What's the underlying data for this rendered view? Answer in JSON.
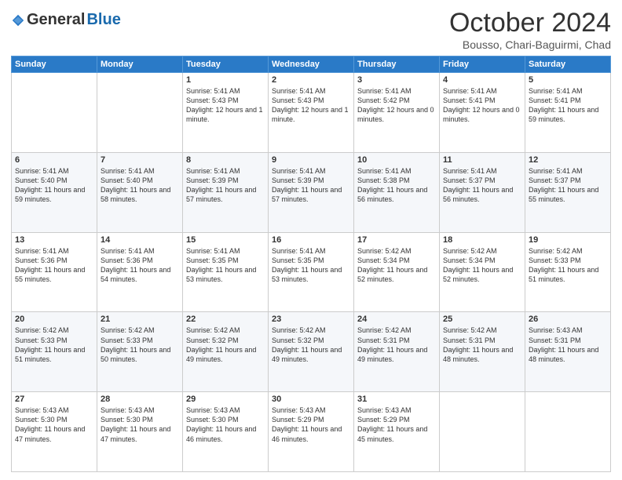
{
  "header": {
    "logo_general": "General",
    "logo_blue": "Blue",
    "month_title": "October 2024",
    "location": "Bousso, Chari-Baguirmi, Chad"
  },
  "days_of_week": [
    "Sunday",
    "Monday",
    "Tuesday",
    "Wednesday",
    "Thursday",
    "Friday",
    "Saturday"
  ],
  "weeks": [
    [
      {
        "day": "",
        "sunrise": "",
        "sunset": "",
        "daylight": ""
      },
      {
        "day": "",
        "sunrise": "",
        "sunset": "",
        "daylight": ""
      },
      {
        "day": "1",
        "sunrise": "Sunrise: 5:41 AM",
        "sunset": "Sunset: 5:43 PM",
        "daylight": "Daylight: 12 hours and 1 minute."
      },
      {
        "day": "2",
        "sunrise": "Sunrise: 5:41 AM",
        "sunset": "Sunset: 5:43 PM",
        "daylight": "Daylight: 12 hours and 1 minute."
      },
      {
        "day": "3",
        "sunrise": "Sunrise: 5:41 AM",
        "sunset": "Sunset: 5:42 PM",
        "daylight": "Daylight: 12 hours and 0 minutes."
      },
      {
        "day": "4",
        "sunrise": "Sunrise: 5:41 AM",
        "sunset": "Sunset: 5:41 PM",
        "daylight": "Daylight: 12 hours and 0 minutes."
      },
      {
        "day": "5",
        "sunrise": "Sunrise: 5:41 AM",
        "sunset": "Sunset: 5:41 PM",
        "daylight": "Daylight: 11 hours and 59 minutes."
      }
    ],
    [
      {
        "day": "6",
        "sunrise": "Sunrise: 5:41 AM",
        "sunset": "Sunset: 5:40 PM",
        "daylight": "Daylight: 11 hours and 59 minutes."
      },
      {
        "day": "7",
        "sunrise": "Sunrise: 5:41 AM",
        "sunset": "Sunset: 5:40 PM",
        "daylight": "Daylight: 11 hours and 58 minutes."
      },
      {
        "day": "8",
        "sunrise": "Sunrise: 5:41 AM",
        "sunset": "Sunset: 5:39 PM",
        "daylight": "Daylight: 11 hours and 57 minutes."
      },
      {
        "day": "9",
        "sunrise": "Sunrise: 5:41 AM",
        "sunset": "Sunset: 5:39 PM",
        "daylight": "Daylight: 11 hours and 57 minutes."
      },
      {
        "day": "10",
        "sunrise": "Sunrise: 5:41 AM",
        "sunset": "Sunset: 5:38 PM",
        "daylight": "Daylight: 11 hours and 56 minutes."
      },
      {
        "day": "11",
        "sunrise": "Sunrise: 5:41 AM",
        "sunset": "Sunset: 5:37 PM",
        "daylight": "Daylight: 11 hours and 56 minutes."
      },
      {
        "day": "12",
        "sunrise": "Sunrise: 5:41 AM",
        "sunset": "Sunset: 5:37 PM",
        "daylight": "Daylight: 11 hours and 55 minutes."
      }
    ],
    [
      {
        "day": "13",
        "sunrise": "Sunrise: 5:41 AM",
        "sunset": "Sunset: 5:36 PM",
        "daylight": "Daylight: 11 hours and 55 minutes."
      },
      {
        "day": "14",
        "sunrise": "Sunrise: 5:41 AM",
        "sunset": "Sunset: 5:36 PM",
        "daylight": "Daylight: 11 hours and 54 minutes."
      },
      {
        "day": "15",
        "sunrise": "Sunrise: 5:41 AM",
        "sunset": "Sunset: 5:35 PM",
        "daylight": "Daylight: 11 hours and 53 minutes."
      },
      {
        "day": "16",
        "sunrise": "Sunrise: 5:41 AM",
        "sunset": "Sunset: 5:35 PM",
        "daylight": "Daylight: 11 hours and 53 minutes."
      },
      {
        "day": "17",
        "sunrise": "Sunrise: 5:42 AM",
        "sunset": "Sunset: 5:34 PM",
        "daylight": "Daylight: 11 hours and 52 minutes."
      },
      {
        "day": "18",
        "sunrise": "Sunrise: 5:42 AM",
        "sunset": "Sunset: 5:34 PM",
        "daylight": "Daylight: 11 hours and 52 minutes."
      },
      {
        "day": "19",
        "sunrise": "Sunrise: 5:42 AM",
        "sunset": "Sunset: 5:33 PM",
        "daylight": "Daylight: 11 hours and 51 minutes."
      }
    ],
    [
      {
        "day": "20",
        "sunrise": "Sunrise: 5:42 AM",
        "sunset": "Sunset: 5:33 PM",
        "daylight": "Daylight: 11 hours and 51 minutes."
      },
      {
        "day": "21",
        "sunrise": "Sunrise: 5:42 AM",
        "sunset": "Sunset: 5:33 PM",
        "daylight": "Daylight: 11 hours and 50 minutes."
      },
      {
        "day": "22",
        "sunrise": "Sunrise: 5:42 AM",
        "sunset": "Sunset: 5:32 PM",
        "daylight": "Daylight: 11 hours and 49 minutes."
      },
      {
        "day": "23",
        "sunrise": "Sunrise: 5:42 AM",
        "sunset": "Sunset: 5:32 PM",
        "daylight": "Daylight: 11 hours and 49 minutes."
      },
      {
        "day": "24",
        "sunrise": "Sunrise: 5:42 AM",
        "sunset": "Sunset: 5:31 PM",
        "daylight": "Daylight: 11 hours and 49 minutes."
      },
      {
        "day": "25",
        "sunrise": "Sunrise: 5:42 AM",
        "sunset": "Sunset: 5:31 PM",
        "daylight": "Daylight: 11 hours and 48 minutes."
      },
      {
        "day": "26",
        "sunrise": "Sunrise: 5:43 AM",
        "sunset": "Sunset: 5:31 PM",
        "daylight": "Daylight: 11 hours and 48 minutes."
      }
    ],
    [
      {
        "day": "27",
        "sunrise": "Sunrise: 5:43 AM",
        "sunset": "Sunset: 5:30 PM",
        "daylight": "Daylight: 11 hours and 47 minutes."
      },
      {
        "day": "28",
        "sunrise": "Sunrise: 5:43 AM",
        "sunset": "Sunset: 5:30 PM",
        "daylight": "Daylight: 11 hours and 47 minutes."
      },
      {
        "day": "29",
        "sunrise": "Sunrise: 5:43 AM",
        "sunset": "Sunset: 5:30 PM",
        "daylight": "Daylight: 11 hours and 46 minutes."
      },
      {
        "day": "30",
        "sunrise": "Sunrise: 5:43 AM",
        "sunset": "Sunset: 5:29 PM",
        "daylight": "Daylight: 11 hours and 46 minutes."
      },
      {
        "day": "31",
        "sunrise": "Sunrise: 5:43 AM",
        "sunset": "Sunset: 5:29 PM",
        "daylight": "Daylight: 11 hours and 45 minutes."
      },
      {
        "day": "",
        "sunrise": "",
        "sunset": "",
        "daylight": ""
      },
      {
        "day": "",
        "sunrise": "",
        "sunset": "",
        "daylight": ""
      }
    ]
  ]
}
